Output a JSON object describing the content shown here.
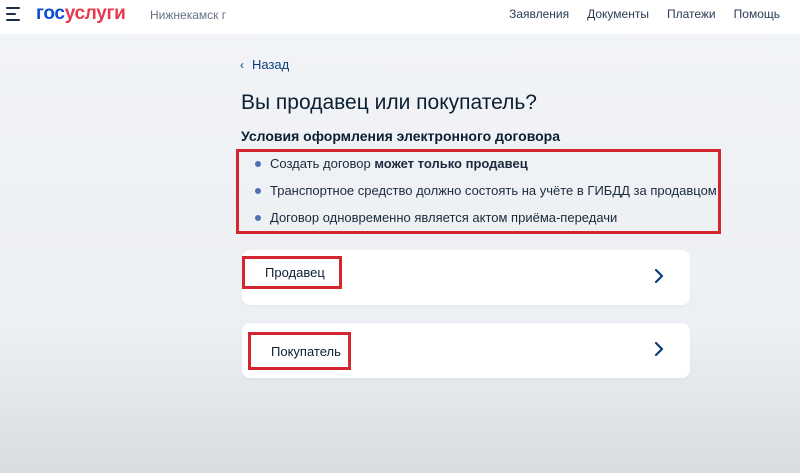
{
  "header": {
    "logo_part1": "гос",
    "logo_part2": "услуги",
    "city": "Нижнекамск г",
    "nav": [
      "Заявления",
      "Документы",
      "Платежи",
      "Помощь"
    ]
  },
  "back_label": "Назад",
  "title": "Вы продавец или покупатель?",
  "subtitle": "Условия оформления электронного договора",
  "conditions": [
    {
      "text": "Создать договор ",
      "bold": "может только продавец"
    },
    {
      "text": "Транспортное средство должно состоять на учёте в ГИБДД за продавцом",
      "bold": ""
    },
    {
      "text": "Договор одновременно является актом приёма-передачи",
      "bold": ""
    }
  ],
  "options": [
    {
      "label": "Продавец"
    },
    {
      "label": "Покупатель"
    }
  ],
  "colors": {
    "brand_blue": "#0d4cd3",
    "brand_red": "#e8384f",
    "highlight_red": "#d4262f"
  }
}
